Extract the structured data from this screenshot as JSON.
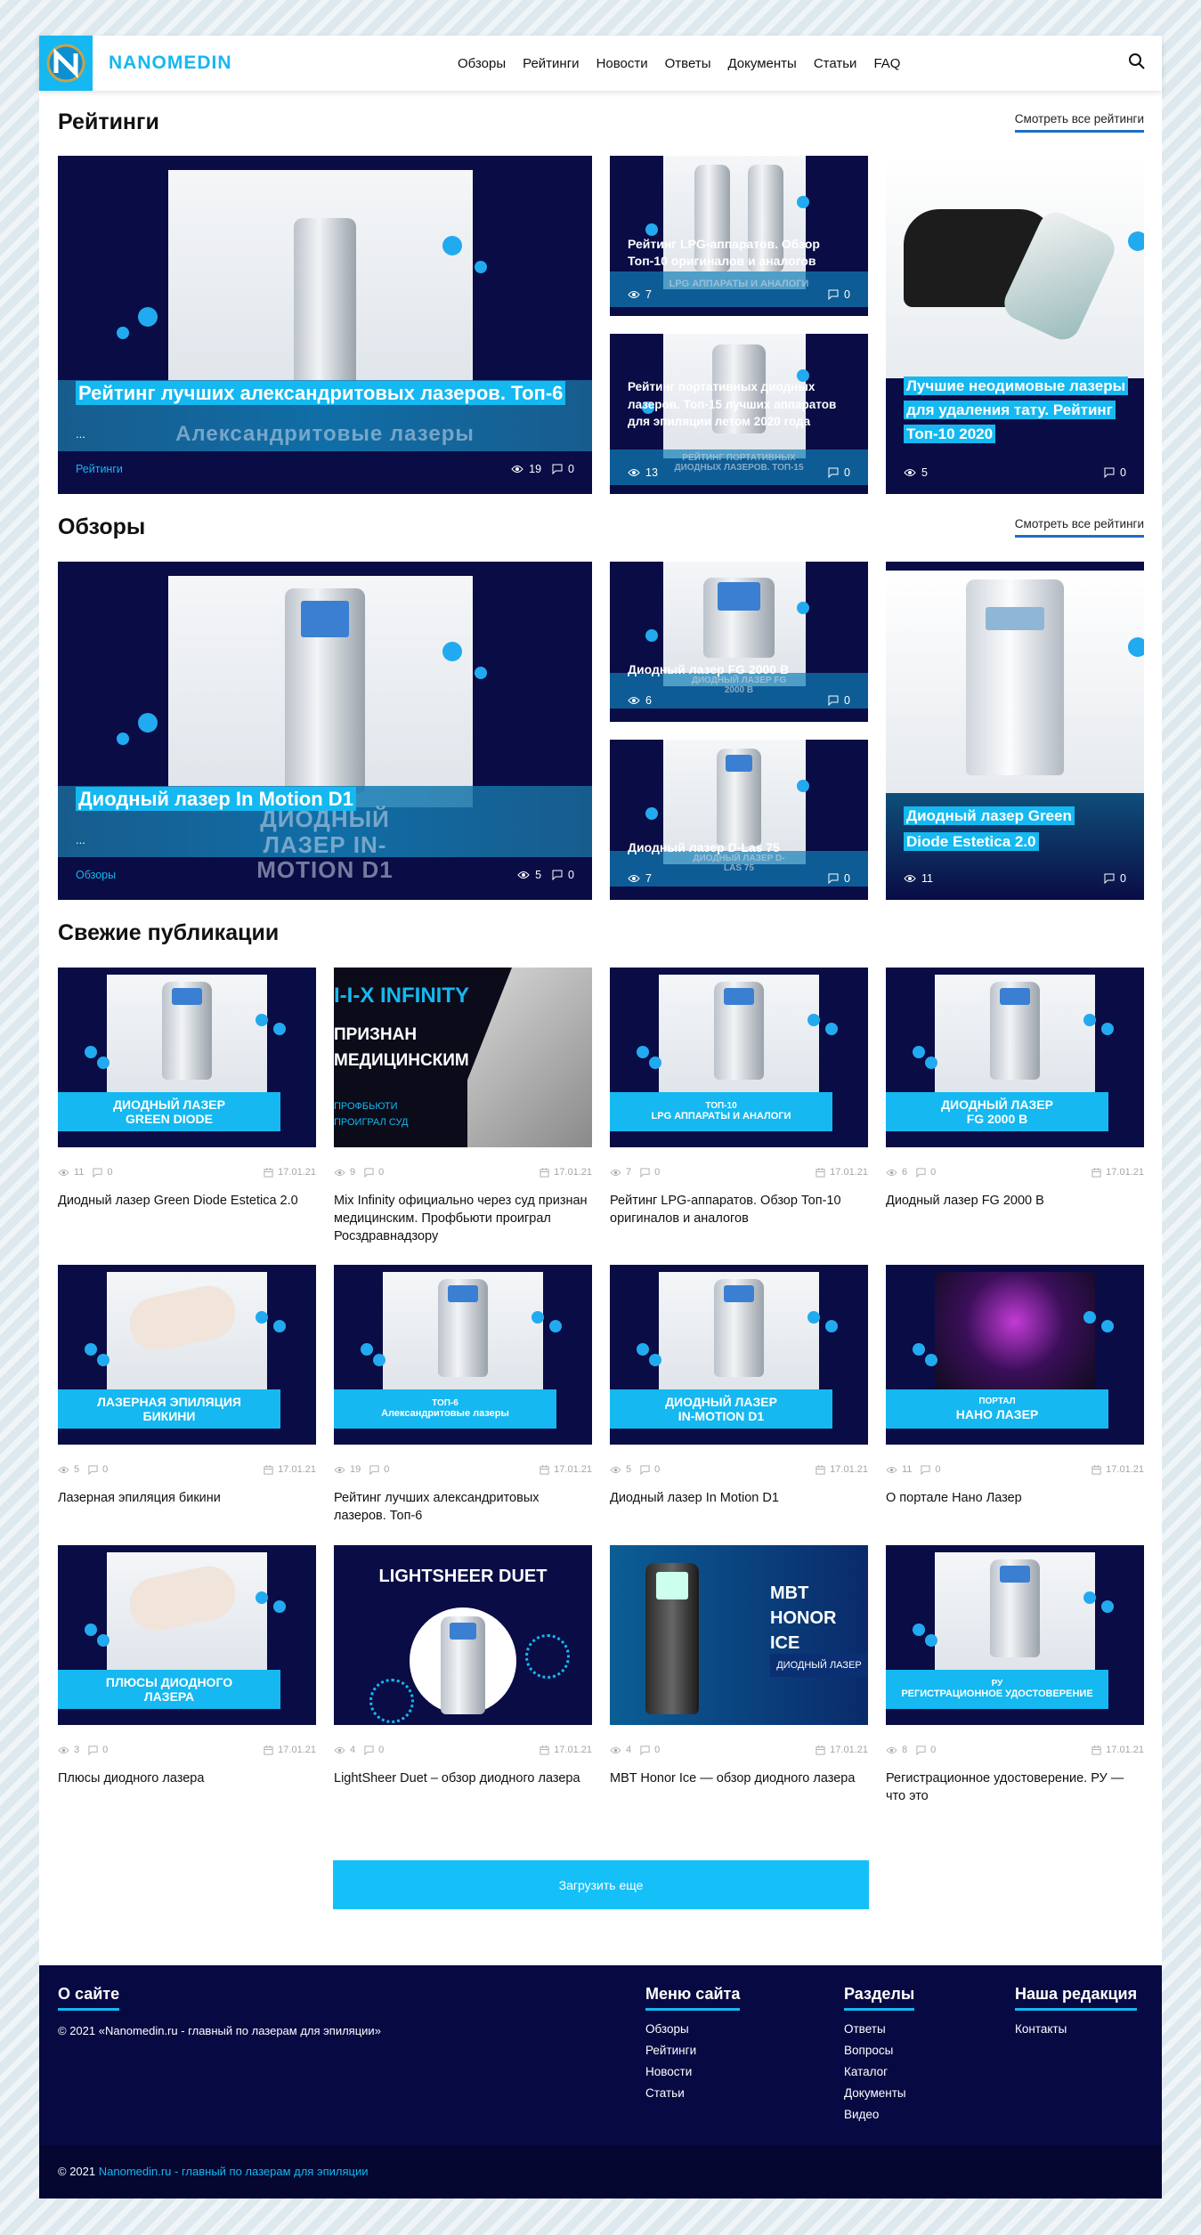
{
  "header": {
    "logo_text": "NANOMEDIN",
    "nav": [
      "Обзоры",
      "Рейтинги",
      "Новости",
      "Ответы",
      "Документы",
      "Статьи",
      "FAQ"
    ]
  },
  "ratings": {
    "title": "Рейтинги",
    "see_all": "Смотреть все рейтинги",
    "big": {
      "title": "Рейтинг лучших александритовых лазеров. Топ-6",
      "dots": "...",
      "tag": "Рейтинги",
      "views": "19",
      "comments": "0",
      "caption": "Александритовые лазеры"
    },
    "small1": {
      "title": "Рейтинг LPG-аппаратов. Обзор Топ-10 оригиналов и аналогов",
      "views": "7",
      "comments": "0",
      "caption": "LPG АППАРАТЫ И АНАЛОГИ"
    },
    "small2": {
      "title": "Рейтинг портативных диодных лазеров. Топ-15 лучших аппаратов для эпиляции летом 2020 года",
      "views": "13",
      "comments": "0",
      "caption": "РЕЙТИНГ ПОРТАТИВНЫХ ДИОДНЫХ ЛАЗЕРОВ. ТОП-15"
    },
    "tall": {
      "title": "Лучшие неодимовые лазеры для удаления тату. Рейтинг Топ-10 2020",
      "views": "5",
      "comments": "0"
    }
  },
  "reviews": {
    "title": "Обзоры",
    "see_all": "Смотреть все рейтинги",
    "big": {
      "title": "Диодный лазер In Motion D1",
      "dots": "...",
      "tag": "Обзоры",
      "views": "5",
      "comments": "0",
      "caption": "ДИОДНЫЙ ЛАЗЕР IN-MOTION D1"
    },
    "small1": {
      "title": "Диодный лазер FG 2000 В",
      "views": "6",
      "comments": "0",
      "caption": "ДИОДНЫЙ ЛАЗЕР FG 2000 B"
    },
    "small2": {
      "title": "Диодный лазер D-Las 75",
      "views": "7",
      "comments": "0",
      "caption": "ДИОДНЫЙ ЛАЗЕР D-LAS 75"
    },
    "tall": {
      "title": "Диодный лазер Green Diode Estetica 2.0",
      "views": "11",
      "comments": "0"
    }
  },
  "fresh": {
    "title": "Свежие публикации",
    "items": [
      {
        "banner1": "ДИОДНЫЙ ЛАЗЕР",
        "banner2": "GREEN DIODE",
        "views": "11",
        "comments": "0",
        "date": "17.01.21",
        "title": "Диодный лазер Green Diode Estetica 2.0"
      },
      {
        "banner1": "I-I-X INFINITY",
        "banner2": "ПРИЗНАН МЕДИЦИНСКИМ",
        "banner3": "ПРОФБЬЮТИ ПРОИГРАЛ СУД",
        "views": "9",
        "comments": "0",
        "date": "17.01.21",
        "title": "Mix Infinity официально через суд признан медицинским. Профбьюти проиграл Росздравнадзору"
      },
      {
        "banner1": "ТОП-10",
        "banner2": "LPG АППАРАТЫ И АНАЛОГИ",
        "views": "7",
        "comments": "0",
        "date": "17.01.21",
        "title": "Рейтинг LPG-аппаратов. Обзор Топ-10 оригиналов и аналогов"
      },
      {
        "banner1": "ДИОДНЫЙ ЛАЗЕР",
        "banner2": "FG 2000 B",
        "views": "6",
        "comments": "0",
        "date": "17.01.21",
        "title": "Диодный лазер FG 2000 В"
      },
      {
        "banner1": "ЛАЗЕРНАЯ ЭПИЛЯЦИЯ",
        "banner2": "БИКИНИ",
        "views": "5",
        "comments": "0",
        "date": "17.01.21",
        "title": "Лазерная эпиляция бикини"
      },
      {
        "banner1": "ТОП-6",
        "banner2": "Александритовые лазеры",
        "views": "19",
        "comments": "0",
        "date": "17.01.21",
        "title": "Рейтинг лучших александритовых лазеров. Топ-6"
      },
      {
        "banner1": "ДИОДНЫЙ ЛАЗЕР",
        "banner2": "IN-MOTION D1",
        "views": "5",
        "comments": "0",
        "date": "17.01.21",
        "title": "Диодный лазер In Motion D1"
      },
      {
        "banner1": "ПОРТАЛ",
        "banner2": "НАНО ЛАЗЕР",
        "views": "11",
        "comments": "0",
        "date": "17.01.21",
        "title": "О портале Нано Лазер"
      },
      {
        "banner1": "ПЛЮСЫ ДИОДНОГО",
        "banner2": "ЛАЗЕРА",
        "views": "3",
        "comments": "0",
        "date": "17.01.21",
        "title": "Плюсы диодного лазера"
      },
      {
        "banner1": "LIGHTSHEER DUET",
        "views": "4",
        "comments": "0",
        "date": "17.01.21",
        "title": "LightSheer Duet – обзор диодного лазера"
      },
      {
        "banner1": "MBT",
        "banner2": "HONOR ICE",
        "banner3": "ДИОДНЫЙ ЛАЗЕР",
        "views": "4",
        "comments": "0",
        "date": "17.01.21",
        "title": "MBT Honor Ice — обзор диодного лазера"
      },
      {
        "banner1": "РУ",
        "banner2": "РЕГИСТРАЦИОННОЕ УДОСТОВЕРЕНИЕ",
        "views": "8",
        "comments": "0",
        "date": "17.01.21",
        "title": "Регистрационное удостоверение. РУ — что это"
      }
    ],
    "load_more": "Загрузить еще"
  },
  "footer": {
    "about_title": "О сайте",
    "about_text": "© 2021 «Nanomedin.ru - главный по лазерам для эпиляции»",
    "menu_title": "Меню сайта",
    "menu": [
      "Обзоры",
      "Рейтинги",
      "Новости",
      "Статьи"
    ],
    "sections_title": "Разделы",
    "sections": [
      "Ответы",
      "Вопросы",
      "Каталог",
      "Документы",
      "Видео"
    ],
    "editorial_title": "Наша редакция",
    "editorial": [
      "Контакты"
    ],
    "copy_prefix": "© 2021",
    "copy_link": "Nanomedin.ru - главный по лазерам для эпиляции"
  },
  "colors": {
    "accent": "#15b8f0",
    "dark_navy": "#070942",
    "link_underline": "#1d6fc4"
  },
  "icons": [
    "logo-icon",
    "search-icon",
    "eye-icon",
    "comment-icon",
    "calendar-icon"
  ]
}
